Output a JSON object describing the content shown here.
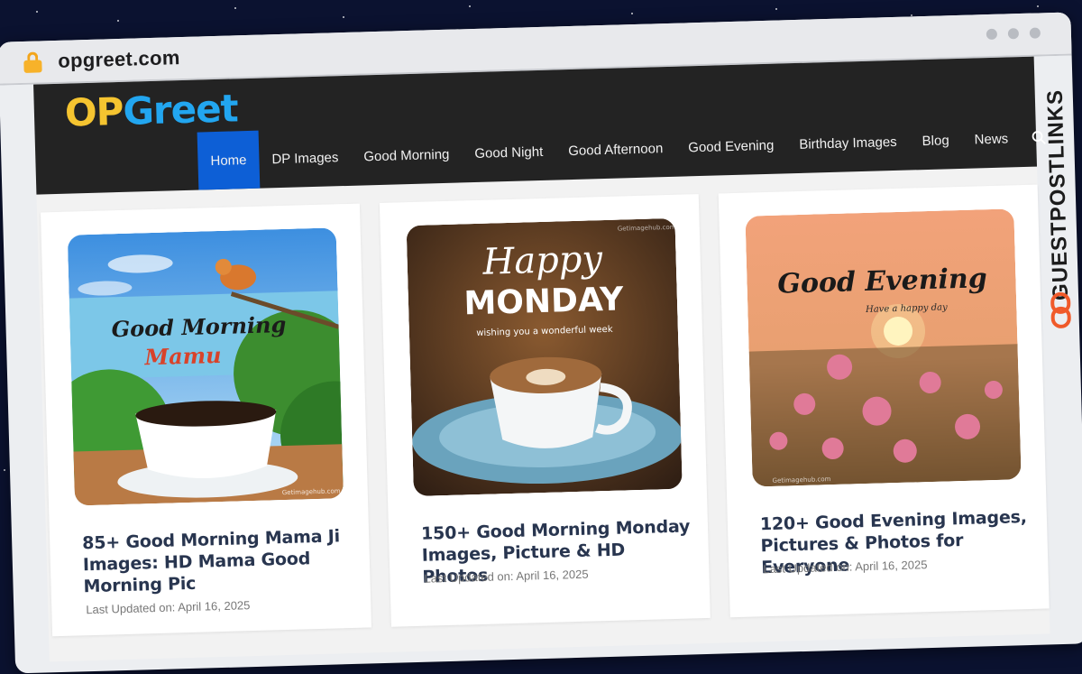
{
  "browser": {
    "url": "opgreet.com"
  },
  "site": {
    "logo_part1": "OP",
    "logo_part2": "Greet",
    "nav": [
      {
        "label": "Home",
        "active": true
      },
      {
        "label": "DP Images"
      },
      {
        "label": "Good Morning"
      },
      {
        "label": "Good Night"
      },
      {
        "label": "Good Afternoon"
      },
      {
        "label": "Good Evening"
      },
      {
        "label": "Birthday Images"
      },
      {
        "label": "Blog"
      },
      {
        "label": "News"
      }
    ]
  },
  "posts": [
    {
      "image_line1": "Good Morning",
      "image_line2": "Mamu",
      "image_watermark": "Getimagehub.com",
      "title": "85+ Good Morning Mama Ji Images: HD Mama Good Morning Pic",
      "updated": "Last Updated on: April 16, 2025"
    },
    {
      "image_line1": "Happy",
      "image_line2": "MONDAY",
      "image_line3": "wishing you a wonderful week",
      "image_watermark": "Getimagehub.com",
      "title": "150+ Good Morning Monday Images, Picture & HD Photos",
      "updated": "Last Updated on: April 16, 2025"
    },
    {
      "image_line1": "Good Evening",
      "image_line2": "Have a happy day",
      "image_watermark": "Getimagehub.com",
      "title": "120+ Good Evening Images, Pictures & Photos for Everyone",
      "updated": "Last Updated on: April 16, 2025"
    }
  ],
  "badge": {
    "text": "GUESTPOSTLINKS"
  },
  "colors": {
    "header_bg": "#232323",
    "nav_active": "#0d5fd6",
    "logo_op": "#f5c430",
    "logo_greet": "#22a6f0",
    "title_text": "#28354f"
  }
}
